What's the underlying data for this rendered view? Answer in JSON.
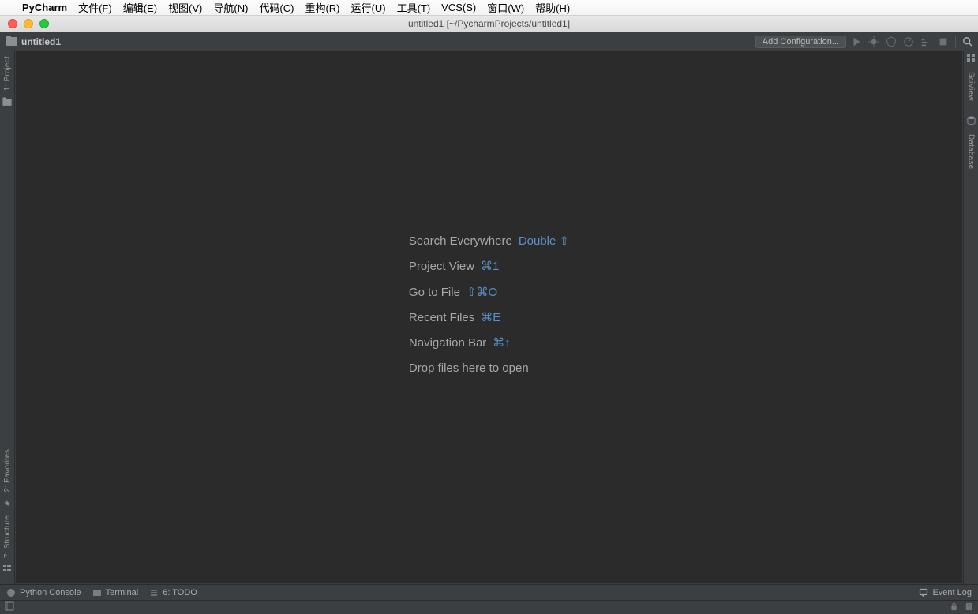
{
  "mac_menu": {
    "app_name": "PyCharm",
    "items": [
      "文件(F)",
      "编辑(E)",
      "视图(V)",
      "导航(N)",
      "代码(C)",
      "重构(R)",
      "运行(U)",
      "工具(T)",
      "VCS(S)",
      "窗口(W)",
      "帮助(H)"
    ]
  },
  "window_title": "untitled1 [~/PycharmProjects/untitled1]",
  "navbar": {
    "breadcrumb": "untitled1",
    "add_configuration": "Add Configuration..."
  },
  "left_tools": {
    "project": "1: Project",
    "favorites": "2: Favorites",
    "structure": "7: Structure"
  },
  "right_tools": {
    "sciview": "SciView",
    "database": "Database"
  },
  "welcome": {
    "rows": [
      {
        "label": "Search Everywhere",
        "short": "Double ⇧"
      },
      {
        "label": "Project View",
        "short": "⌘1"
      },
      {
        "label": "Go to File",
        "short": "⇧⌘O"
      },
      {
        "label": "Recent Files",
        "short": "⌘E"
      },
      {
        "label": "Navigation Bar",
        "short": "⌘↑"
      }
    ],
    "drop_hint": "Drop files here to open"
  },
  "bottom": {
    "python_console": "Python Console",
    "terminal": "Terminal",
    "todo": "6: TODO",
    "event_log": "Event Log"
  }
}
